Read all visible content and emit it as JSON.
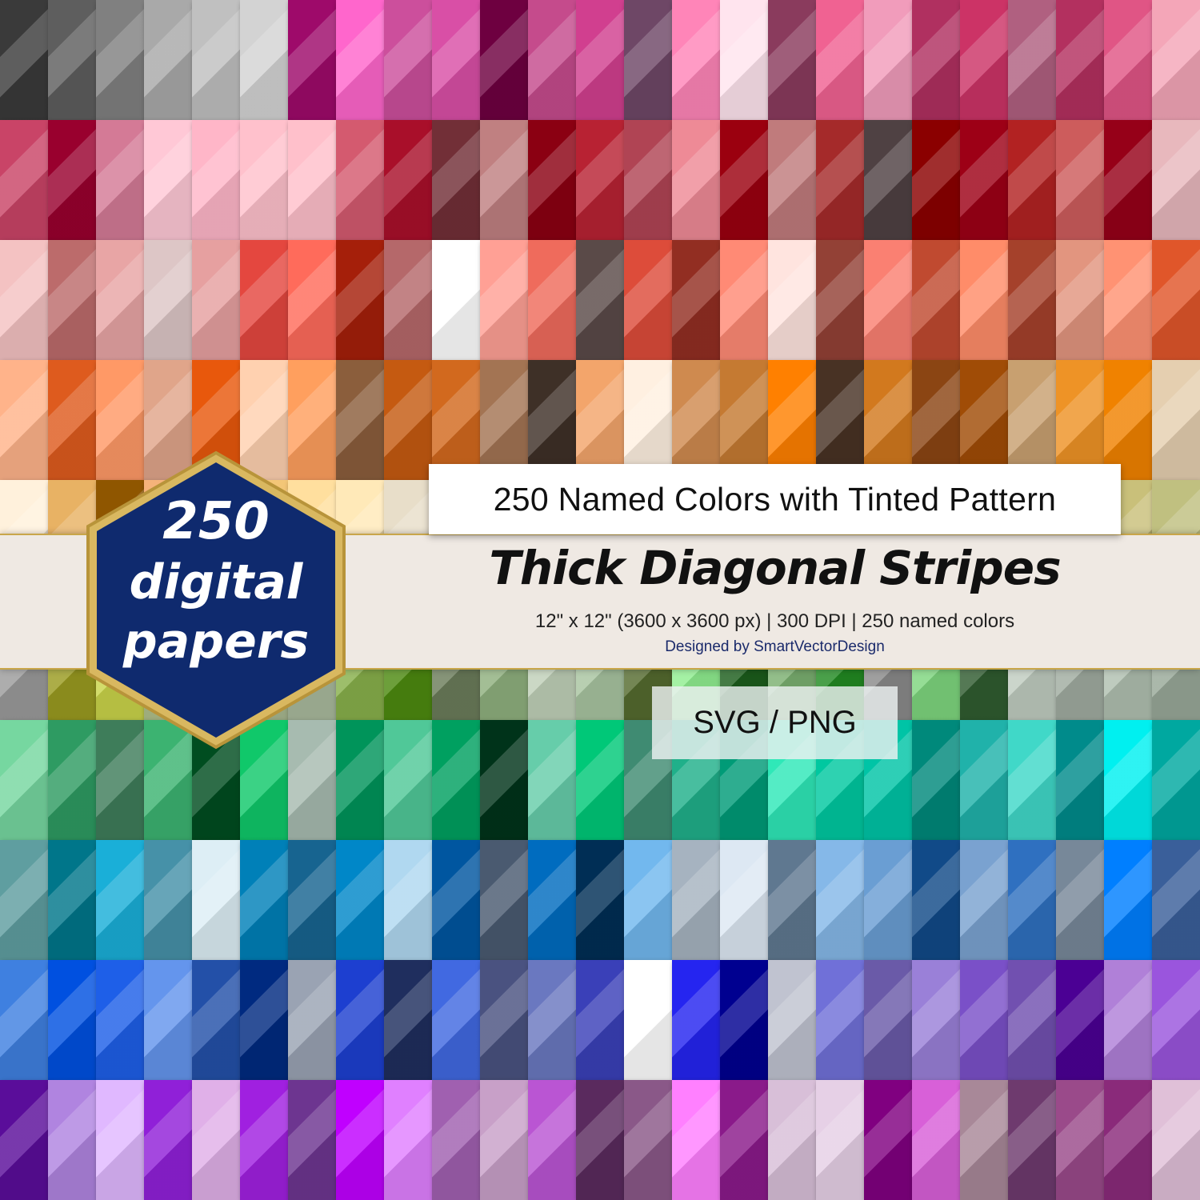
{
  "title_box": {
    "text": "250 Named Colors with Tinted Pattern"
  },
  "headline": "Thick Diagonal Stripes",
  "spec": "12\" x 12\" (3600 x 3600 px) | 300 DPI | 250 named colors",
  "credit": "Designed by SmartVectorDesign",
  "format": "SVG / PNG",
  "badge": {
    "line1": "250",
    "line2": "digital",
    "line3": "papers",
    "fill": "#0f2a6e",
    "border": "#c9a64a"
  },
  "swatch_rows": [
    [
      "#3a3a3a",
      "#5e5e5e",
      "#808080",
      "#a9a9a9",
      "#c0c0c0",
      "#d3d3d3",
      "#9e0a6a",
      "#ff66cc",
      "#cc4f9c",
      "#d94fa6",
      "#6e0040",
      "#c54b8c",
      "#d13f8f",
      "#6e4766",
      "#ff85b8",
      "#ffe4ee",
      "#8a3b5d",
      "#f06292",
      "#f19cbb",
      "#b03060",
      "#cc3366",
      "#b06080",
      "#b3305f",
      "#e05585",
      "#f4a6b8"
    ],
    [
      "#c94467",
      "#99002e",
      "#d47a96",
      "#ffc8d6",
      "#ffb6c8",
      "#ffc1cc",
      "#ffc0cb",
      "#d45a6f",
      "#a90f2a",
      "#722f37",
      "#c08081",
      "#8b0012",
      "#b82233",
      "#b04454",
      "#ee8a96",
      "#9b000f",
      "#c07b7c",
      "#a52a2a",
      "#4f4143",
      "#8b0000",
      "#9d0016",
      "#b22222",
      "#cd5c5c",
      "#960018",
      "#e8b8bd"
    ],
    [
      "#f4c2c2",
      "#bc6b6b",
      "#e8a5a5",
      "#ddc6c6",
      "#e6a0a0",
      "#e4473f",
      "#ff6b5b",
      "#a51f0a",
      "#b5686a",
      "#ffffff",
      "#ffa095",
      "#ef6b5c",
      "#5a4a48",
      "#dd4c3a",
      "#922e22",
      "#ff8a75",
      "#ffe4df",
      "#934136",
      "#fa8072",
      "#c04a30",
      "#ff8c69",
      "#a5412b",
      "#e2957f",
      "#ff9273",
      "#e0562a"
    ],
    [
      "#ffb38a",
      "#de5b1e",
      "#ff9966",
      "#e0a58a",
      "#e8580c",
      "#ffd1b0",
      "#ff9f5e",
      "#8b5e3c",
      "#c55a11",
      "#d2691e",
      "#a37453",
      "#3e3027",
      "#f3a56b",
      "#fff0e1",
      "#cf8a4f",
      "#c57a32",
      "#ff8000",
      "#483224",
      "#d2791e",
      "#8b4513",
      "#a04c06",
      "#c8a070",
      "#ee9326",
      "#f08200",
      "#e5cfb0"
    ],
    [
      "#fff1dc",
      "#e8b264",
      "#8f5600",
      "#f5b37a",
      "#ffe0a8",
      "#f3c677",
      "#ffdf9e",
      "#ffe9b8",
      "#e8dec9",
      "#f0e4c0",
      "#d9c48e",
      "#c6b67e",
      "#ddd58d",
      "#f0e68c",
      "#eee8aa",
      "#d6cc7a",
      "#bdb76b",
      "#c2b280",
      "#cfc07e",
      "#a8a860",
      "#e4d96f",
      "#d8d2a0",
      "#b8b878",
      "#c9c07a",
      "#c0c080"
    ],
    [
      "#9b9b9b",
      "#9a9b20",
      "#c9d44a",
      "#b0c08a",
      "#bfd8a0",
      "#a8b890",
      "#a9ba9d",
      "#88b04b",
      "#4d8a10",
      "#6b7c5a",
      "#8fb07e",
      "#c0d0b8",
      "#a8c4a0",
      "#556b2f",
      "#90ee90",
      "#1c5e1c",
      "#7bb070",
      "#228b22",
      "#8a8a8a",
      "#7ed67e",
      "#305c30",
      "#c0ccc0",
      "#a0aca0",
      "#b0c0b0",
      "#98a898"
    ],
    [
      "#76d7a0",
      "#2e9b62",
      "#3e7d5a",
      "#3cb371",
      "#004d20",
      "#10c86a",
      "#a7bbb0",
      "#00945a",
      "#50c898",
      "#00a060",
      "#00331a",
      "#66cdaa",
      "#00c878",
      "#3f8b72",
      "#20b08a",
      "#009b77",
      "#2fe8b8",
      "#00c8a0",
      "#00c4a6",
      "#00897b",
      "#20b2aa",
      "#40d8c8",
      "#008b8b",
      "#00f0f0",
      "#00a8a0"
    ],
    [
      "#5f9ea0",
      "#00768a",
      "#1aafd8",
      "#4691a8",
      "#ddeef5",
      "#0080b8",
      "#176490",
      "#0087c8",
      "#b0d8f0",
      "#0056a0",
      "#4a5a70",
      "#006cbf",
      "#002e55",
      "#72b8ee",
      "#a6b3c0",
      "#dde8f3",
      "#5f7890",
      "#85b8e8",
      "#6a9ed3",
      "#114a88",
      "#7aa2d0",
      "#2f70c0",
      "#778899",
      "#007fff",
      "#3a5f9a"
    ],
    [
      "#3f80e0",
      "#0050e0",
      "#1e5fe8",
      "#6495ed",
      "#2350a8",
      "#002a80",
      "#9aa3b3",
      "#1d3fd0",
      "#1f2e5e",
      "#4169e1",
      "#4a5280",
      "#6a78c0",
      "#3a40b8",
      "#ffffff",
      "#2525f0",
      "#000090",
      "#c0c3d0",
      "#7070d8",
      "#6a5aa8",
      "#9a80d8",
      "#7a50c8",
      "#7150b0",
      "#4b0094",
      "#b080d8",
      "#9a55dd"
    ],
    [
      "#5a0d9a",
      "#b084e0",
      "#e0b8ff",
      "#9020d8",
      "#e0b0e8",
      "#a020e0",
      "#6d3590",
      "#c000ff",
      "#e080ff",
      "#a060b0",
      "#c8a0c8",
      "#ba55d3",
      "#5a2a5e",
      "#8a5888",
      "#ff80ff",
      "#8a1a8a",
      "#d8bfd8",
      "#e6d0e6",
      "#800080",
      "#d860d8",
      "#a88898",
      "#6e3a6e",
      "#9a4a8a",
      "#8a2a7a",
      "#e0c0d8"
    ]
  ]
}
